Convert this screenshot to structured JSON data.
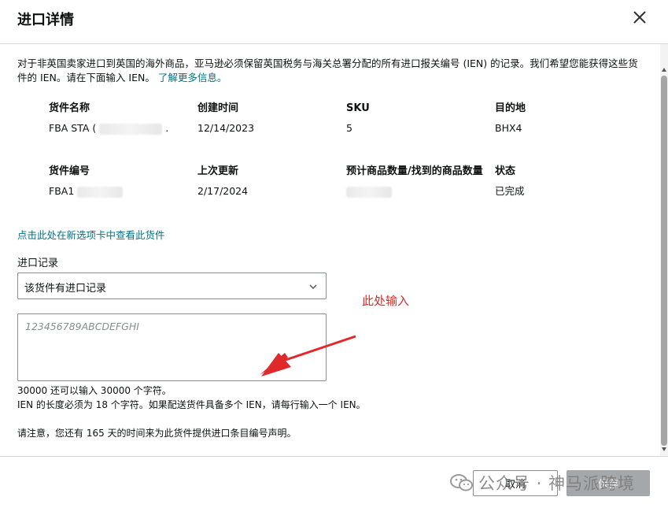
{
  "dialog": {
    "title": "进口详情",
    "close_icon": "close-icon"
  },
  "intro": {
    "text": "对于非英国卖家进口到英国的海外商品，亚马逊必须保留英国税务与海关总署分配的所有进口报关编号 (IEN) 的记录。我们希望您能获得这些货件的 IEN。请在下面输入 IEN。",
    "link": "了解更多信息。"
  },
  "shipment": {
    "name_header": "货件名称",
    "name_value": "FBA STA (",
    "name_suffix": ".",
    "created_header": "创建时间",
    "created_value": "12/14/2023",
    "sku_header": "SKU",
    "sku_value": "5",
    "dest_header": "目的地",
    "dest_value": "BHX4",
    "id_header": "货件编号",
    "id_value": "FBA1",
    "updated_header": "上次更新",
    "updated_value": "2/17/2024",
    "qty_header": "预计商品数量/找到的商品数量",
    "status_header": "状态",
    "status_value": "已完成"
  },
  "view_link": "点击此处在新选项卡中查看此货件",
  "import_record": {
    "label": "进口记录",
    "selected": "该货件有进口记录",
    "placeholder": "123456789ABCDEFGHI"
  },
  "notes": {
    "chars_left": "30000 还可以输入 30000 个字符。",
    "ien_rule": "IEN 的长度必须为 18 个字符。如果配送货件具备多个 IEN，请每行输入一个 IEN。",
    "deadline": "请注意，您还有 165 天的时间来为此货件提供进口条目编号声明。"
  },
  "annotation": {
    "text": "此处输入",
    "color": "#e0292b"
  },
  "footer": {
    "cancel_label": "取消",
    "save_label": "保存"
  },
  "watermark": {
    "text": "公众号 · 神马派跨境"
  },
  "colors": {
    "link": "#007185",
    "save_disabled": "#a5a8ab"
  }
}
